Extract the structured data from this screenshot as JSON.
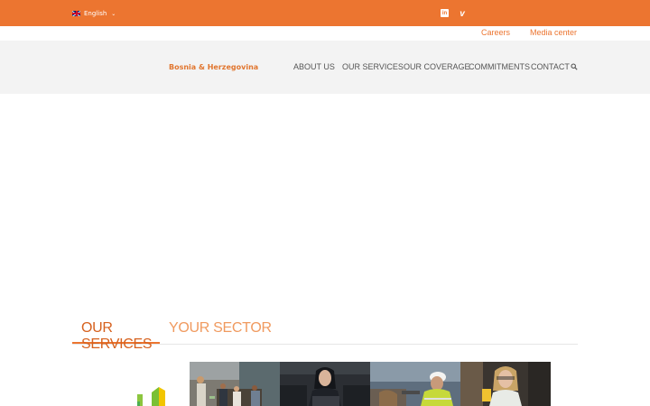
{
  "topbar": {
    "language": "English",
    "social": [
      "linkedin-icon",
      "vimeo-icon"
    ]
  },
  "toplinks": {
    "careers": "Careers",
    "media": "Media center"
  },
  "header": {
    "brand": "Bosnia & Herzegovina",
    "nav": [
      "ABOUT US",
      "OUR SERVICES",
      "OUR COVERAGE",
      "COMMITMENTS",
      "CONTACT"
    ]
  },
  "tabs": [
    "OUR SERVICES",
    "YOUR SECTOR"
  ],
  "colors": {
    "accent": "#ec7530",
    "header_bg": "#f3f3f3"
  }
}
